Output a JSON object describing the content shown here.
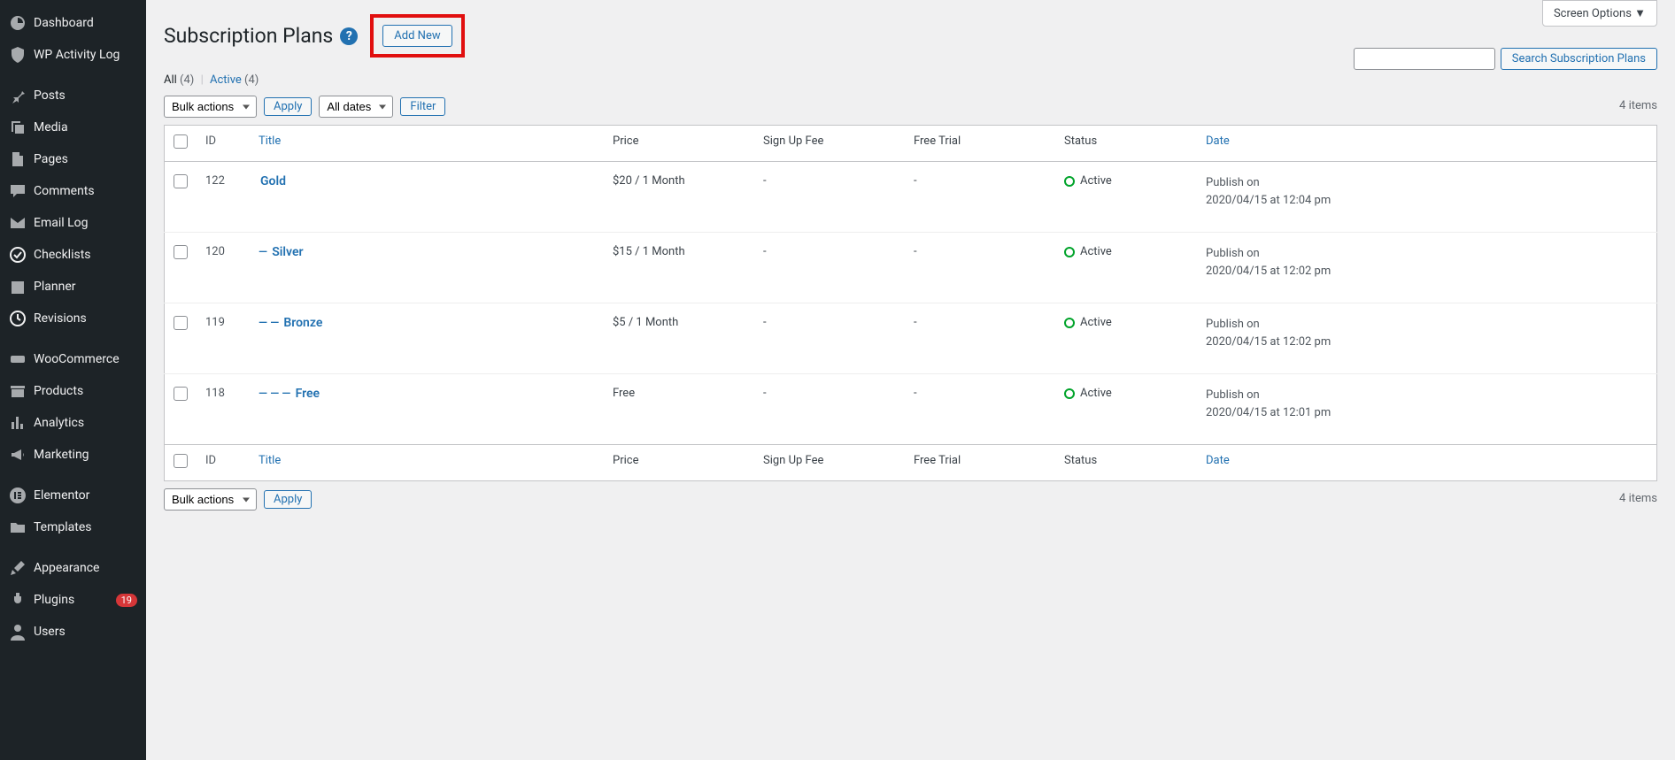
{
  "screen_options": "Screen Options ▼",
  "page_title": "Subscription Plans",
  "add_new": "Add New",
  "filters": {
    "all_label": "All",
    "all_count": "(4)",
    "active_label": "Active",
    "active_count": "(4)"
  },
  "bulk_actions": "Bulk actions",
  "apply": "Apply",
  "all_dates": "All dates",
  "filter": "Filter",
  "search_btn": "Search Subscription Plans",
  "items_count": "4 items",
  "columns": {
    "id": "ID",
    "title": "Title",
    "price": "Price",
    "fee": "Sign Up Fee",
    "trial": "Free Trial",
    "status": "Status",
    "date": "Date"
  },
  "rows": [
    {
      "id": "122",
      "prefix": "",
      "title": "Gold",
      "price": "$20 / 1 Month",
      "fee": "-",
      "trial": "-",
      "status": "Active",
      "date1": "Publish on",
      "date2": "2020/04/15 at 12:04 pm"
    },
    {
      "id": "120",
      "prefix": "— ",
      "title": "Silver",
      "price": "$15 / 1 Month",
      "fee": "-",
      "trial": "-",
      "status": "Active",
      "date1": "Publish on",
      "date2": "2020/04/15 at 12:02 pm"
    },
    {
      "id": "119",
      "prefix": "— — ",
      "title": "Bronze",
      "price": "$5 / 1 Month",
      "fee": "-",
      "trial": "-",
      "status": "Active",
      "date1": "Publish on",
      "date2": "2020/04/15 at 12:02 pm"
    },
    {
      "id": "118",
      "prefix": "— — — ",
      "title": "Free",
      "price": "Free",
      "fee": "-",
      "trial": "-",
      "status": "Active",
      "date1": "Publish on",
      "date2": "2020/04/15 at 12:01 pm"
    }
  ],
  "sidebar": [
    {
      "label": "Dashboard",
      "icon": "dashboard"
    },
    {
      "label": "WP Activity Log",
      "icon": "shield"
    },
    {
      "sep": true
    },
    {
      "label": "Posts",
      "icon": "pin"
    },
    {
      "label": "Media",
      "icon": "media"
    },
    {
      "label": "Pages",
      "icon": "page"
    },
    {
      "label": "Comments",
      "icon": "comment"
    },
    {
      "label": "Email Log",
      "icon": "mail"
    },
    {
      "label": "Checklists",
      "icon": "check"
    },
    {
      "label": "Planner",
      "icon": "calendar"
    },
    {
      "label": "Revisions",
      "icon": "clock"
    },
    {
      "sep": true
    },
    {
      "label": "WooCommerce",
      "icon": "woo"
    },
    {
      "label": "Products",
      "icon": "archive"
    },
    {
      "label": "Analytics",
      "icon": "bars"
    },
    {
      "label": "Marketing",
      "icon": "megaphone"
    },
    {
      "sep": true
    },
    {
      "label": "Elementor",
      "icon": "elementor"
    },
    {
      "label": "Templates",
      "icon": "folder"
    },
    {
      "sep": true
    },
    {
      "label": "Appearance",
      "icon": "brush"
    },
    {
      "label": "Plugins",
      "icon": "plug",
      "badge": "19"
    },
    {
      "label": "Users",
      "icon": "user"
    }
  ]
}
